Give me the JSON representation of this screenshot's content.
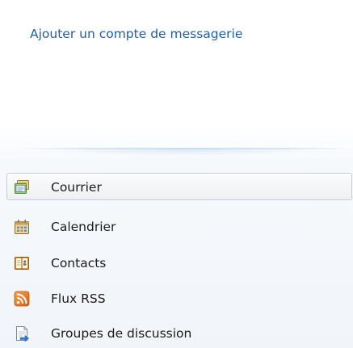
{
  "account": {
    "add_link": "Ajouter un compte de messagerie"
  },
  "nav": {
    "selected": "Courrier",
    "items": [
      {
        "label": "Courrier",
        "icon": "mail-icon",
        "selected": true
      },
      {
        "label": "Calendrier",
        "icon": "calendar-icon",
        "selected": false
      },
      {
        "label": "Contacts",
        "icon": "contacts-icon",
        "selected": false
      },
      {
        "label": "Flux RSS",
        "icon": "rss-feed-icon",
        "selected": false
      },
      {
        "label": "Groupes de discussion",
        "icon": "newsgroups-icon",
        "selected": false
      }
    ]
  },
  "colors": {
    "link": "#1f5fa8",
    "text": "#1b1b1b",
    "nav_background": "#f3f7fb",
    "rss_orange": "#e8731e"
  }
}
